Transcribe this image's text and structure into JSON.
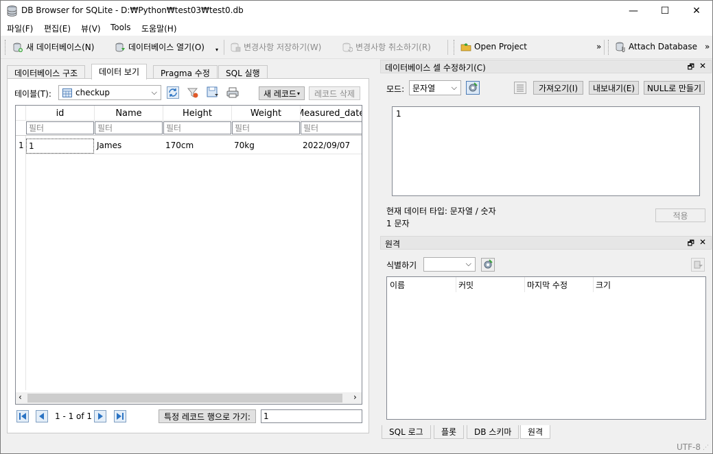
{
  "window": {
    "title": "DB Browser for SQLite - D:₩Python₩test03₩test0.db",
    "minimize": "—",
    "maximize": "☐",
    "close": "✕"
  },
  "menu": [
    "파일(F)",
    "편집(E)",
    "뷰(V)",
    "Tools",
    "도움말(H)"
  ],
  "toolbar": {
    "new_db": "새 데이터베이스(N)",
    "open_db": "데이터베이스 열기(O)",
    "write_changes": "변경사항 저장하기(W)",
    "revert_changes": "변경사항 취소하기(R)",
    "open_project": "Open Project",
    "attach_db": "Attach Database",
    "more": "»"
  },
  "main_tabs": [
    "데이터베이스 구조",
    "데이터 보기",
    "Pragma 수정",
    "SQL 실행"
  ],
  "browse": {
    "table_label": "테이블(T):",
    "table_value": "checkup",
    "new_record": "새 레코드",
    "delete_record": "레코드 삭제",
    "columns": [
      "id",
      "Name",
      "Height",
      "Weight",
      "Measured_date"
    ],
    "filter_placeholder": "필터",
    "rows": [
      {
        "rownum": "1",
        "cells": [
          "1",
          "James",
          "170cm",
          "70kg",
          "2022/09/07"
        ]
      }
    ],
    "pager_text": "1 - 1 of 1",
    "goto_label": "특정 레코드 행으로 가기:",
    "goto_value": "1"
  },
  "edit_cell": {
    "title": "데이터베이스 셀 수정하기(C)",
    "mode_label": "모드:",
    "mode_value": "문자열",
    "import": "가져오기(I)",
    "export": "내보내기(E)",
    "set_null": "NULL로 만들기",
    "value": "1",
    "type_info": "현재 데이터 타입: 문자열 / 숫자",
    "size_info": "1 문자",
    "apply": "적용"
  },
  "remote": {
    "title": "원격",
    "identity_label": "식별하기",
    "columns": [
      "이름",
      "커밋",
      "마지막 수정",
      "크기"
    ]
  },
  "bottom_tabs": [
    "SQL 로그",
    "플롯",
    "DB 스키마",
    "원격"
  ],
  "status": {
    "encoding": "UTF-8"
  }
}
